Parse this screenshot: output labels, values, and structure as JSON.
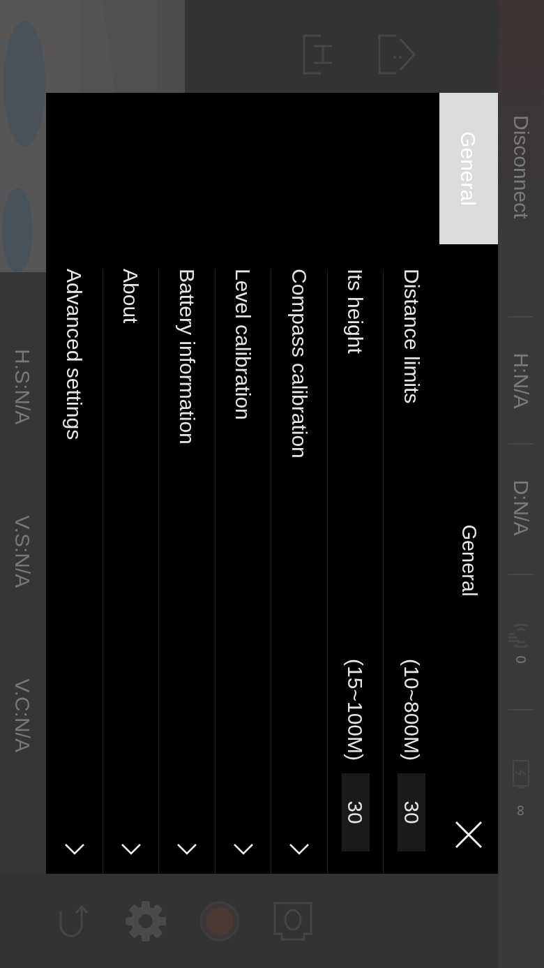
{
  "status_bar": {
    "connection": "Disconnect",
    "readings": [
      "H:N/A",
      "D:N/A"
    ],
    "signal_reading": "0",
    "battery_reading": "∞"
  },
  "telemetry": [
    "H.S:N/A",
    "V.S:N/A",
    "V.C:N/A"
  ],
  "dialog": {
    "tabs": [
      {
        "label": "General",
        "selected": true
      }
    ],
    "title": "General",
    "rows": [
      {
        "kind": "input",
        "label": "Distance limits",
        "range": "(10~800M)",
        "value": "30"
      },
      {
        "kind": "input",
        "label": "Its height",
        "range": "(15~100M)",
        "value": "30"
      },
      {
        "kind": "expand",
        "label": "Compass calibration",
        "expanded": false
      },
      {
        "kind": "expand",
        "label": "Level calibration",
        "expanded": false
      },
      {
        "kind": "expand",
        "label": "Battery information",
        "expanded": false
      },
      {
        "kind": "expand",
        "label": "About",
        "expanded": false
      },
      {
        "kind": "expand",
        "label": "Advanced settings",
        "expanded": false
      }
    ]
  }
}
